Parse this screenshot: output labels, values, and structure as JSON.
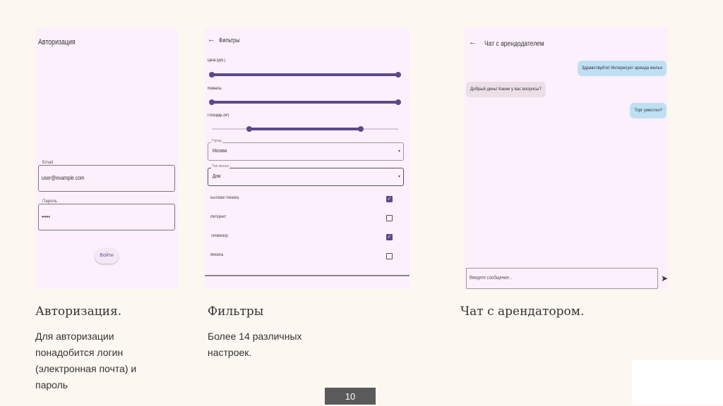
{
  "auth_screen": {
    "title": "Авторизация",
    "email_label": "Email",
    "email_value": "user@example.com",
    "password_label": "Пароль",
    "password_value": "•••••",
    "login_button": "Войти"
  },
  "filters_screen": {
    "back_icon": "arrow-left-icon",
    "title": "Фильтры",
    "price_label": "Цена (руб.)",
    "price_range": [
      0,
      100
    ],
    "rooms_label": "Комнаты",
    "rooms_range": [
      0,
      100
    ],
    "area_label": "Площадь (м²)",
    "area_range": [
      20,
      80
    ],
    "city_label": "Город",
    "city_value": "Москва",
    "type_label": "Тип жилья",
    "type_value": "Дом",
    "checkboxes": [
      {
        "label": "Бытовая техника",
        "checked": true
      },
      {
        "label": "Интернет",
        "checked": false
      },
      {
        "label": "Телевизор",
        "checked": true
      },
      {
        "label": "Мебель",
        "checked": false
      }
    ]
  },
  "chat_screen": {
    "back_icon": "arrow-left-icon",
    "title": "Чат с арендодателем",
    "messages": [
      {
        "text": "Здравствуйте! Интересует аренда жилья",
        "from": "me"
      },
      {
        "text": "Добрый день! Какие у вас вопросы?",
        "from": "them"
      },
      {
        "text": "Торг уместен?",
        "from": "me"
      }
    ],
    "input_placeholder": "Введите сообщение...",
    "send_icon": "send-icon"
  },
  "captions": {
    "auth_title": "Авторизация.",
    "auth_text": "Для авторизации понадобится логин (электронная почта) и пароль",
    "filters_title": "Фильтры",
    "filters_text": "Более 14 различных настроек.",
    "chat_title": "Чат с арендатором."
  },
  "page_number": "10",
  "colors": {
    "accent": "#5a4a8a",
    "screen_bg": "#fbf0fb",
    "page_bg": "#fdf7f1",
    "my_bubble": "#bfe0f3"
  }
}
